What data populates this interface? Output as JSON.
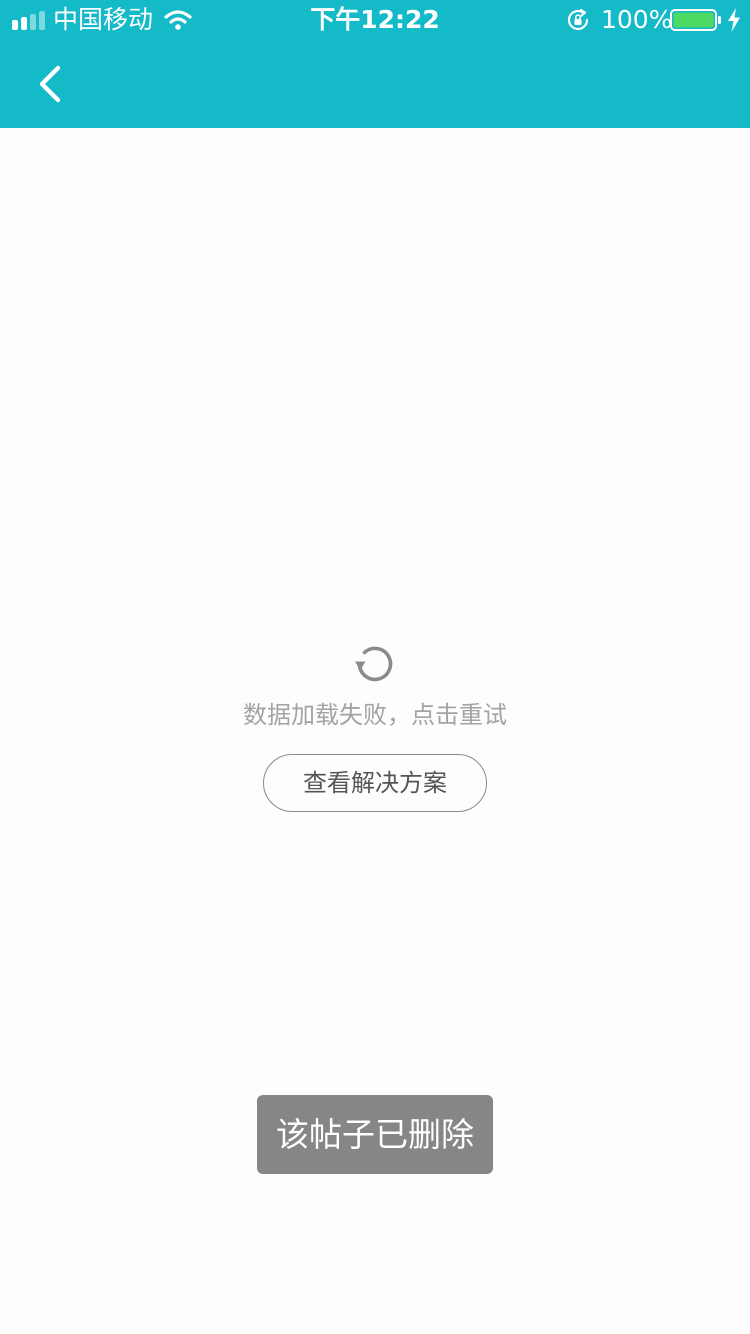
{
  "status_bar": {
    "carrier": "中国移动",
    "time": "下午12:22",
    "battery_percent": "100%",
    "signal_icon": "signal-bars-icon",
    "wifi_icon": "wifi-icon",
    "rotation_lock_icon": "rotation-lock-icon",
    "battery_icon": "battery-icon",
    "charging_icon": "charging-bolt-icon",
    "battery_level": 1.0,
    "battery_fill_color": "#4cd964"
  },
  "nav": {
    "back_icon": "chevron-left-icon",
    "background_color": "#15bac8"
  },
  "error": {
    "reload_icon": "reload-icon",
    "message": "数据加载失败，点击重试",
    "solution_button": "查看解决方案"
  },
  "toast": {
    "message": "该帖子已删除"
  }
}
